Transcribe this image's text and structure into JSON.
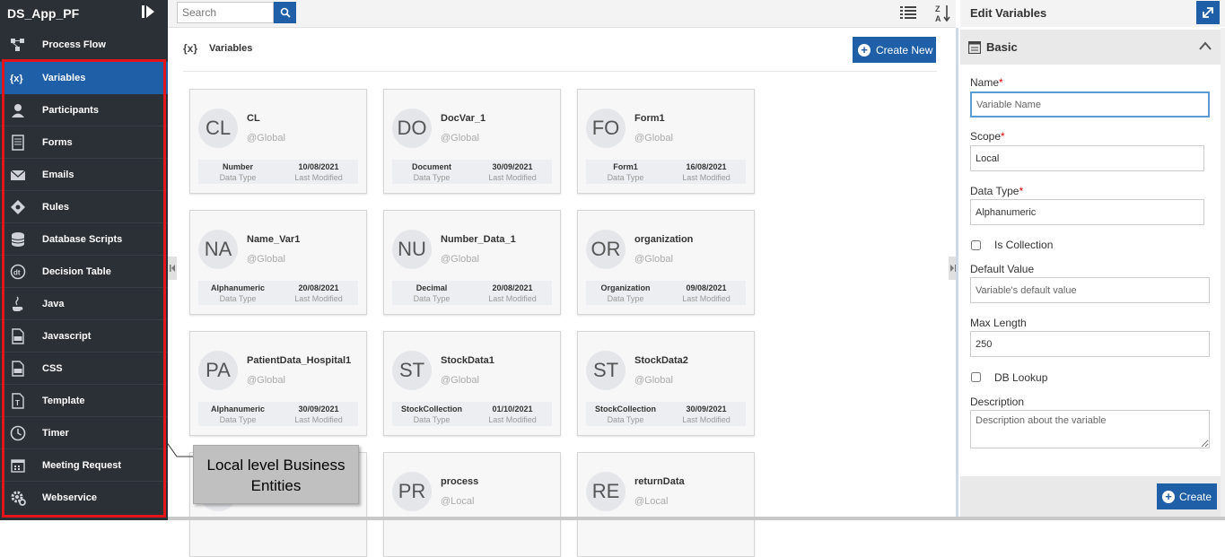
{
  "app": {
    "title": "DS_App_PF"
  },
  "sidebar": {
    "items": [
      {
        "label": "Process Flow",
        "icon": "process-flow-icon",
        "active": false
      },
      {
        "label": "Variables",
        "icon": "variables-icon",
        "active": true
      },
      {
        "label": "Participants",
        "icon": "participants-icon",
        "active": false
      },
      {
        "label": "Forms",
        "icon": "forms-icon",
        "active": false
      },
      {
        "label": "Emails",
        "icon": "envelope-icon",
        "active": false
      },
      {
        "label": "Rules",
        "icon": "rules-icon",
        "active": false
      },
      {
        "label": "Database Scripts",
        "icon": "database-icon",
        "active": false
      },
      {
        "label": "Decision Table",
        "icon": "decision-table-icon",
        "active": false
      },
      {
        "label": "Java",
        "icon": "java-icon",
        "active": false
      },
      {
        "label": "Javascript",
        "icon": "javascript-icon",
        "active": false
      },
      {
        "label": "CSS",
        "icon": "css-icon",
        "active": false
      },
      {
        "label": "Template",
        "icon": "template-icon",
        "active": false
      },
      {
        "label": "Timer",
        "icon": "clock-icon",
        "active": false
      },
      {
        "label": "Meeting Request",
        "icon": "calendar-icon",
        "active": false
      },
      {
        "label": "Webservice",
        "icon": "gear-icon",
        "active": false
      }
    ]
  },
  "toolbar": {
    "search_placeholder": "Search"
  },
  "variables": {
    "badge": "{x}",
    "title": "Variables",
    "create_new_label": "Create New",
    "data_type_caption": "Data Type",
    "last_modified_caption": "Last Modified",
    "cards": [
      {
        "initials": "CL",
        "name": "CL",
        "scope": "@Global",
        "data_type": "Number",
        "last_modified": "10/08/2021"
      },
      {
        "initials": "DO",
        "name": "DocVar_1",
        "scope": "@Global",
        "data_type": "Document",
        "last_modified": "30/09/2021"
      },
      {
        "initials": "FO",
        "name": "Form1",
        "scope": "@Global",
        "data_type": "Form1",
        "last_modified": "16/08/2021"
      },
      {
        "initials": "NA",
        "name": "Name_Var1",
        "scope": "@Global",
        "data_type": "Alphanumeric",
        "last_modified": "20/08/2021"
      },
      {
        "initials": "NU",
        "name": "Number_Data_1",
        "scope": "@Global",
        "data_type": "Decimal",
        "last_modified": "20/08/2021"
      },
      {
        "initials": "OR",
        "name": "organization",
        "scope": "@Global",
        "data_type": "Organization",
        "last_modified": "09/08/2021"
      },
      {
        "initials": "PA",
        "name": "PatientData_Hospital1",
        "scope": "@Global",
        "data_type": "Alphanumeric",
        "last_modified": "30/09/2021"
      },
      {
        "initials": "ST",
        "name": "StockData1",
        "scope": "@Global",
        "data_type": "StockCollection",
        "last_modified": "01/10/2021"
      },
      {
        "initials": "ST",
        "name": "StockData2",
        "scope": "@Global",
        "data_type": "StockCollection",
        "last_modified": "30/09/2021"
      },
      {
        "initials": "",
        "name": "",
        "scope": "",
        "data_type": "",
        "last_modified": ""
      },
      {
        "initials": "PR",
        "name": "process",
        "scope": "@Local",
        "data_type": "",
        "last_modified": ""
      },
      {
        "initials": "RE",
        "name": "returnData",
        "scope": "@Local",
        "data_type": "",
        "last_modified": ""
      }
    ]
  },
  "annotation": {
    "text": "Local level Business Entities"
  },
  "edit_panel": {
    "title": "Edit Variables",
    "section_title": "Basic",
    "name_label": "Name",
    "name_placeholder": "Variable Name",
    "scope_label": "Scope",
    "scope_value": "Local",
    "data_type_label": "Data Type",
    "data_type_value": "Alphanumeric",
    "is_collection_label": "Is Collection",
    "default_value_label": "Default Value",
    "default_value_placeholder": "Variable's default value",
    "max_length_label": "Max Length",
    "max_length_value": "250",
    "db_lookup_label": "DB Lookup",
    "description_label": "Description",
    "description_placeholder": "Description about the variable",
    "required_mark": "*",
    "create_label": "Create"
  },
  "colors": {
    "sidebar_bg": "#2b2f36",
    "accent": "#1f5fa8",
    "highlight_border": "#e3151a"
  }
}
